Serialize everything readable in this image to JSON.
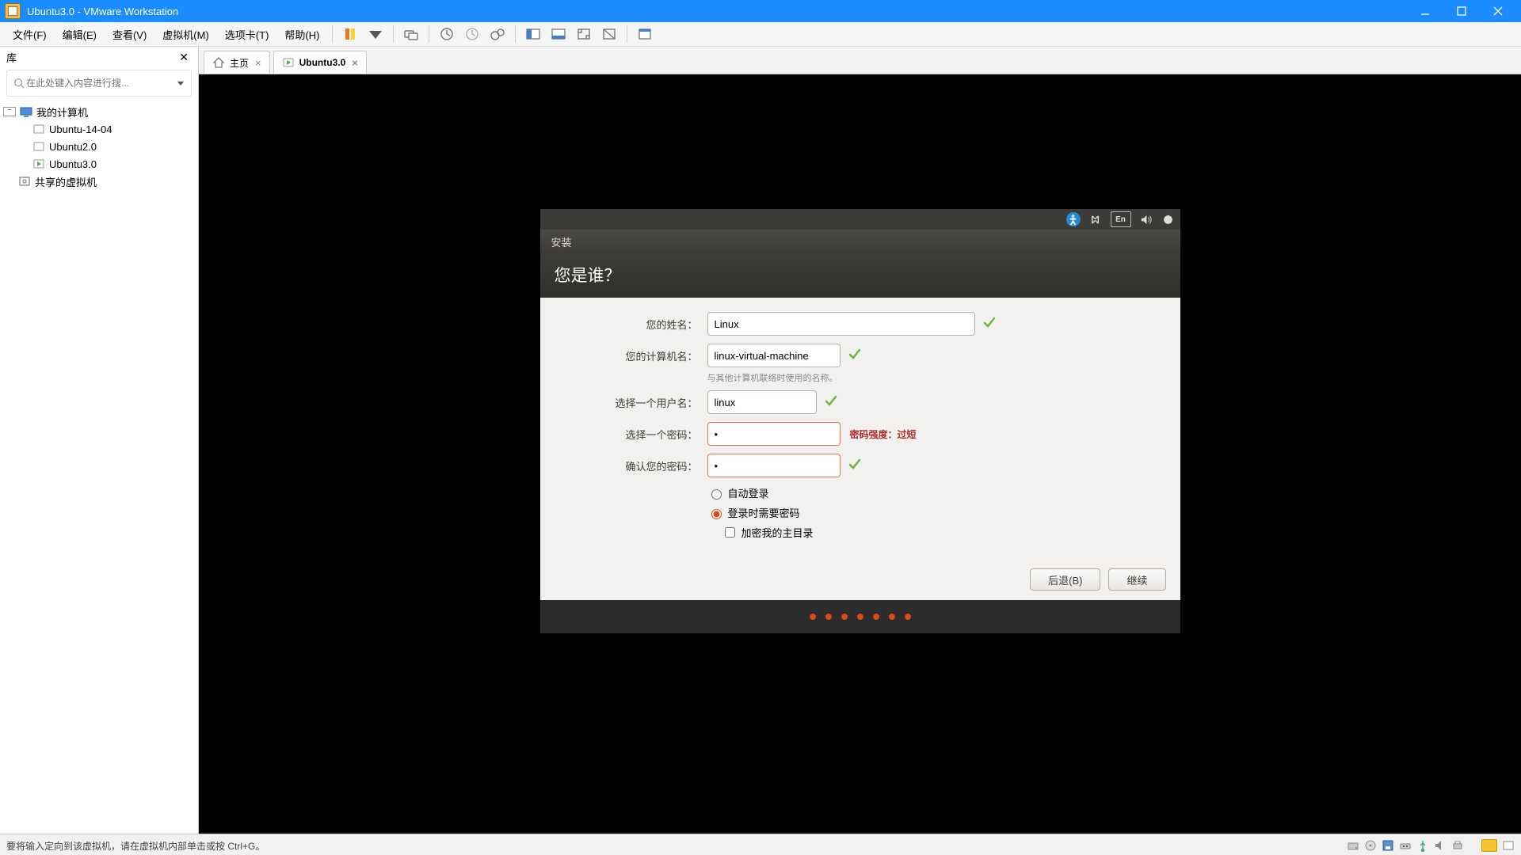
{
  "titlebar": {
    "title": "Ubuntu3.0 - VMware Workstation"
  },
  "menu": {
    "file": "文件(F)",
    "edit": "编辑(E)",
    "view": "查看(V)",
    "vm": "虚拟机(M)",
    "tabs": "选项卡(T)",
    "help": "帮助(H)"
  },
  "sidebar": {
    "header": "库",
    "search_placeholder": "在此处键入内容进行搜...",
    "root": "我的计算机",
    "items": [
      "Ubuntu-14-04",
      "Ubuntu2.0",
      "Ubuntu3.0"
    ],
    "shared": "共享的虚拟机"
  },
  "tabs": {
    "home": "主页",
    "vm": "Ubuntu3.0"
  },
  "ubuntu": {
    "toolbar_en": "En",
    "winTitle": "安装",
    "heading": "您是谁？",
    "labels": {
      "name": "您的姓名：",
      "host": "您的计算机名：",
      "hostHint": "与其他计算机联络时使用的名称。",
      "user": "选择一个用户名：",
      "pass": "选择一个密码：",
      "confirm": "确认您的密码：",
      "auto": "自动登录",
      "require": "登录时需要密码",
      "encrypt": "加密我的主目录"
    },
    "values": {
      "name": "Linux",
      "host": "linux-virtual-machine",
      "user": "linux",
      "pass": "•",
      "confirm": "•"
    },
    "passStrength": "密码强度：过短",
    "buttons": {
      "back": "后退(B)",
      "continue": "继续"
    }
  },
  "status": {
    "msg": "要将输入定向到该虚拟机，请在虚拟机内部单击或按 Ctrl+G。"
  }
}
